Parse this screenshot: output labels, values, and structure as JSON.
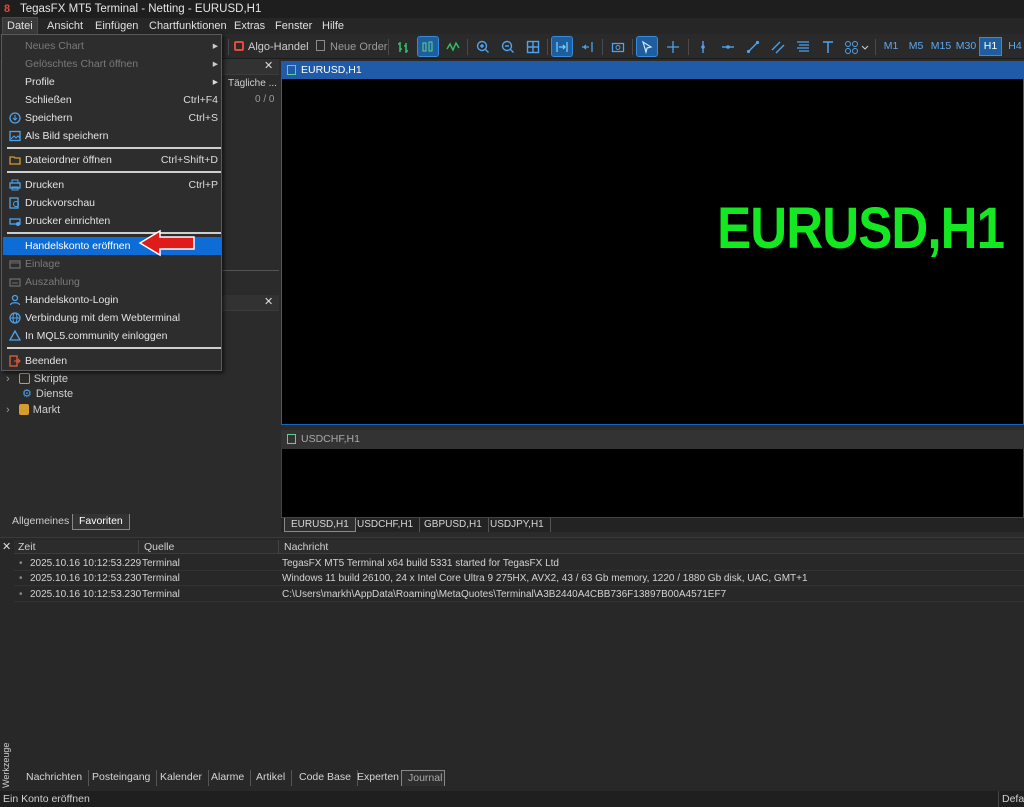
{
  "window": {
    "title": "TegasFX MT5 Terminal - Netting - EURUSD,H1"
  },
  "menubar": {
    "items": [
      "Datei",
      "Ansicht",
      "Einfügen",
      "Chartfunktionen",
      "Extras",
      "Fenster",
      "Hilfe"
    ]
  },
  "toolbar": {
    "algo_label": "Algo-Handel",
    "order_label": "Neue Order",
    "timeframes": [
      "M1",
      "M5",
      "M15",
      "M30",
      "H1",
      "H4"
    ],
    "selected_timeframe": "H1"
  },
  "file_menu": {
    "items": [
      {
        "label": "Neues Chart",
        "shortcut": "",
        "disabled": true,
        "submenu": true,
        "icon": "none"
      },
      {
        "label": "Gelöschtes Chart öffnen",
        "shortcut": "",
        "disabled": true,
        "submenu": true,
        "icon": "none"
      },
      {
        "label": "Profile",
        "shortcut": "",
        "disabled": false,
        "submenu": true,
        "icon": "none"
      },
      {
        "label": "Schließen",
        "shortcut": "Ctrl+F4",
        "disabled": false,
        "submenu": false,
        "icon": "none"
      },
      {
        "label": "Speichern",
        "shortcut": "Ctrl+S",
        "disabled": false,
        "submenu": false,
        "icon": "save-icon"
      },
      {
        "label": "Als Bild speichern",
        "shortcut": "",
        "disabled": false,
        "submenu": false,
        "icon": "image-icon"
      },
      {
        "label": "Dateiordner öffnen",
        "shortcut": "Ctrl+Shift+D",
        "disabled": false,
        "submenu": false,
        "icon": "folder-icon"
      },
      {
        "label": "Drucken",
        "shortcut": "Ctrl+P",
        "disabled": false,
        "submenu": false,
        "icon": "printer-icon"
      },
      {
        "label": "Druckvorschau",
        "shortcut": "",
        "disabled": false,
        "submenu": false,
        "icon": "print-preview-icon"
      },
      {
        "label": "Drucker einrichten",
        "shortcut": "",
        "disabled": false,
        "submenu": false,
        "icon": "printer-setup-icon"
      },
      {
        "label": "Handelskonto eröffnen",
        "shortcut": "",
        "disabled": false,
        "submenu": false,
        "icon": "none",
        "highlighted": true
      },
      {
        "label": "Einlage",
        "shortcut": "",
        "disabled": true,
        "submenu": false,
        "icon": "deposit-icon"
      },
      {
        "label": "Auszahlung",
        "shortcut": "",
        "disabled": true,
        "submenu": false,
        "icon": "withdraw-icon"
      },
      {
        "label": "Handelskonto-Login",
        "shortcut": "",
        "disabled": false,
        "submenu": false,
        "icon": "user-icon"
      },
      {
        "label": "Verbindung mit dem Webterminal",
        "shortcut": "",
        "disabled": false,
        "submenu": false,
        "icon": "globe-icon"
      },
      {
        "label": "In MQL5.community einloggen",
        "shortcut": "",
        "disabled": false,
        "submenu": false,
        "icon": "mql5-icon"
      },
      {
        "label": "Beenden",
        "shortcut": "",
        "disabled": false,
        "submenu": false,
        "icon": "exit-icon"
      }
    ]
  },
  "market_watch": {
    "column": "Tägliche ...",
    "count": "0 / 0"
  },
  "navigator": {
    "items": [
      "Skripte",
      "Dienste",
      "Markt"
    ]
  },
  "left_tabs": [
    "Allgemeines",
    "Favoriten"
  ],
  "charts": {
    "main_title": "EURUSD,H1",
    "overlay_text": "EURUSD,H1",
    "secondary_title": "USDCHF,H1",
    "tabs": [
      "EURUSD,H1",
      "USDCHF,H1",
      "GBPUSD,H1",
      "USDJPY,H1"
    ]
  },
  "journal": {
    "columns": [
      "Zeit",
      "Quelle",
      "Nachricht"
    ],
    "rows": [
      {
        "time": "2025.10.16 10:12:53.229",
        "source": "Terminal",
        "message": "TegasFX MT5 Terminal x64 build 5331 started for TegasFX Ltd"
      },
      {
        "time": "2025.10.16 10:12:53.230",
        "source": "Terminal",
        "message": "Windows 11 build 26100, 24 x Intel Core Ultra 9 275HX, AVX2, 43 / 63 Gb memory, 1220 / 1880 Gb disk, UAC, GMT+1"
      },
      {
        "time": "2025.10.16 10:12:53.230",
        "source": "Terminal",
        "message": "C:\\Users\\markh\\AppData\\Roaming\\MetaQuotes\\Terminal\\A3B2440A4CBB736F13897B00A4571EF7"
      }
    ]
  },
  "toolbox": {
    "side_label": "Werkzeuge",
    "tabs": [
      "Nachrichten",
      "Posteingang",
      "Kalender",
      "Alarme",
      "Artikel",
      "Code Base",
      "Experten",
      "Journal"
    ]
  },
  "status": {
    "left": "Ein Konto eröffnen",
    "right": "Defau"
  },
  "colors": {
    "overlay_green": "#13e820",
    "highlight": "#0d6cd6",
    "arrow": "#e01b1b"
  }
}
